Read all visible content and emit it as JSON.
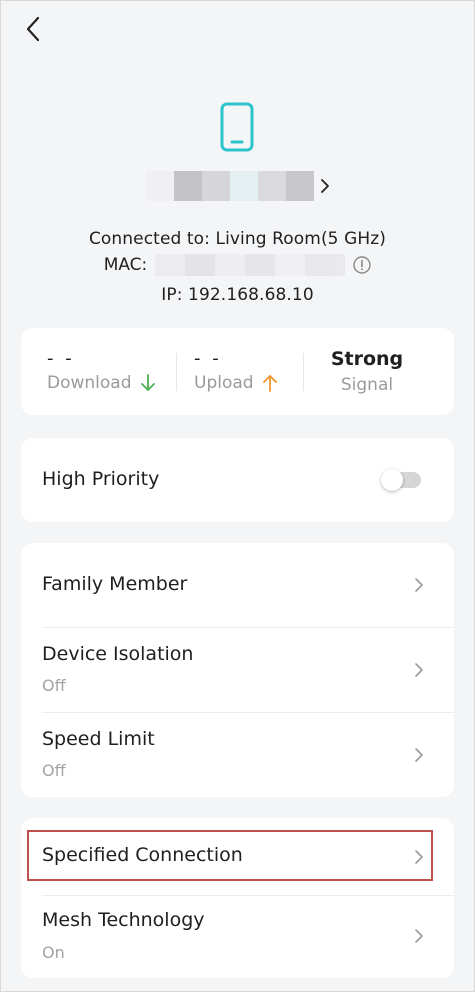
{
  "device": {
    "connected_to": "Connected to: Living Room(5 GHz)",
    "mac_label": "MAC:",
    "ip": "IP: 192.168.68.10"
  },
  "stats": {
    "download_value": "- -",
    "download_label": "Download",
    "upload_value": "- -",
    "upload_label": "Upload",
    "signal_value": "Strong",
    "signal_label": "Signal"
  },
  "priority": {
    "label": "High Priority",
    "enabled": false
  },
  "settings": {
    "family_member": "Family Member",
    "device_isolation": "Device Isolation",
    "device_isolation_value": "Off",
    "speed_limit": "Speed Limit",
    "speed_limit_value": "Off"
  },
  "connection": {
    "specified_connection": "Specified Connection",
    "mesh_technology": "Mesh Technology",
    "mesh_technology_value": "On"
  },
  "colors": {
    "accent_cyan": "#2bc4cc",
    "download_arrow": "#4cb050",
    "upload_arrow": "#f0962a",
    "highlight": "#c0504d"
  }
}
